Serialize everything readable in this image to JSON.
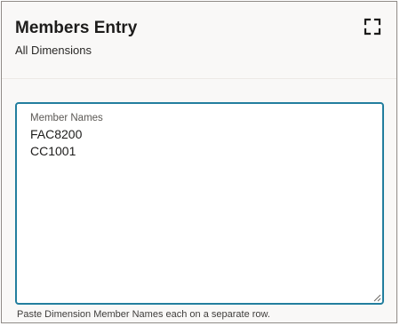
{
  "header": {
    "title": "Members Entry",
    "subtitle": "All Dimensions",
    "expand_icon": "expand-icon"
  },
  "field": {
    "label": "Member Names",
    "value": "FAC8200\nCC1001",
    "helper": "Paste Dimension Member Names each on a separate row."
  },
  "colors": {
    "focus_border": "#227e9e",
    "panel_background": "#f9f8f7"
  }
}
